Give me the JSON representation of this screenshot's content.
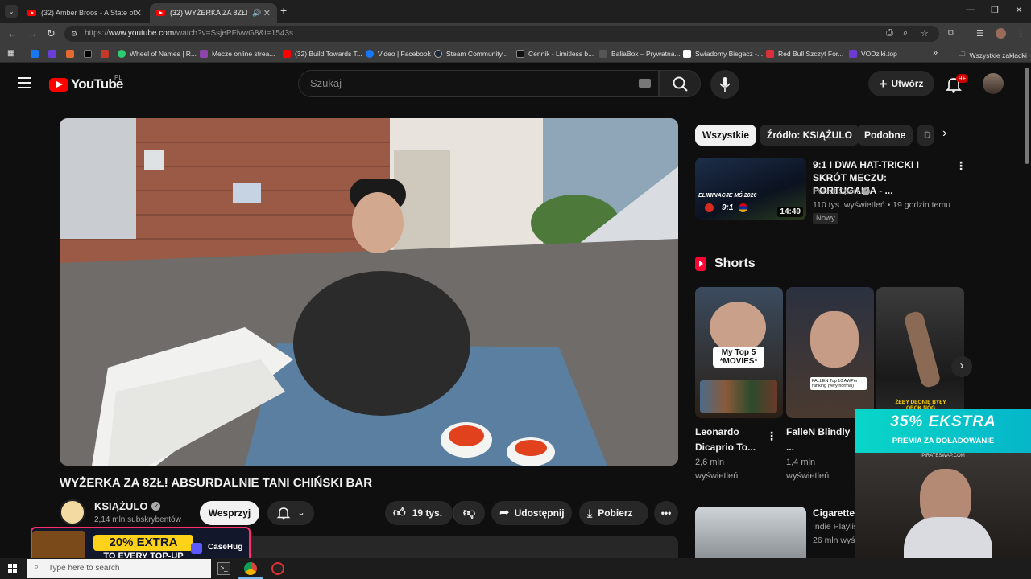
{
  "browser": {
    "tabs": [
      {
        "label": "(32) Amber Broos - A State of T"
      },
      {
        "label": "(32) WYŻERKA ZA 8ZŁ! ABS"
      }
    ],
    "url_prefix": "https://",
    "url_host": "www.youtube.com",
    "url_path": "/watch?v=SsjePFlvwG8&t=1543s",
    "bookmarks": [
      {
        "label": "",
        "color": "#1877f2"
      },
      {
        "label": "",
        "color": "#6a3fd8"
      },
      {
        "label": "",
        "color": "#e46a2f"
      },
      {
        "label": "",
        "color": "#000000"
      },
      {
        "label": "",
        "color": "#c0392b"
      },
      {
        "label": "Wheel of Names | R...",
        "color": "#2ecc71"
      },
      {
        "label": "Mecze online strea...",
        "color": "#8e44ad"
      },
      {
        "label": "(32) Build Towards T...",
        "color": "#ff0000"
      },
      {
        "label": "Video | Facebook",
        "color": "#1877f2"
      },
      {
        "label": "Steam Community...",
        "color": "#1b2838"
      },
      {
        "label": "Cennik - Limitless b...",
        "color": "#111111"
      },
      {
        "label": "BaliaBox – Prywatna...",
        "color": "#555555"
      },
      {
        "label": "Świadomy Biegacz -...",
        "color": "#ffffff"
      },
      {
        "label": "Red Bull Szczyt For...",
        "color": "#d9303a"
      },
      {
        "label": "VODziki.top",
        "color": "#6c3bd1"
      }
    ],
    "all_bookmarks": "Wszystkie zakładki"
  },
  "youtube": {
    "logo_text": "YouTube",
    "country": "PL",
    "search_placeholder": "Szukaj",
    "create_label": "Utwórz",
    "notifications_badge": "9+"
  },
  "video": {
    "title": "WYŻERKA ZA 8ZŁ! ABSURDALNIE TANI CHIŃSKI BAR",
    "channel": "KSIĄŻULO",
    "subscribers": "2,14 mln subskrybentów",
    "support_label": "Wesprzyj",
    "likes": "19 tys.",
    "share_label": "Udostępnij",
    "download_label": "Pobierz"
  },
  "sidebar": {
    "chips": [
      "Wszystkie",
      "Źródło: KSIĄŻULO",
      "Podobne",
      "D"
    ],
    "recommended": {
      "title": "9:1 I DWA HAT-TRICKI I SKRÓT MECZU: PORTUGALIA - ...",
      "channel": "Polsat Sport",
      "meta": "110 tys. wyświetleń • 19 godzin temu",
      "badge": "Nowy",
      "duration": "14:49",
      "thumb_text": "ELIMINACJE MŚ 2026",
      "score": "9:1"
    },
    "shorts_heading": "Shorts",
    "shorts": [
      {
        "title": "Leonardo Dicaprio To...",
        "views": "2,6 mln",
        "views_label": "wyświetleń",
        "thumb_text": "My Top 5 *MOVIES*"
      },
      {
        "title": "FalleN Blindly ...",
        "views": "1,4 mln",
        "views_label": "wyświetleń",
        "thumb_text": "FALLEN Top 10 AWPer ranking (very normal)"
      },
      {
        "title": "",
        "views": "",
        "views_label": "",
        "thumb_text": "ŻEBY DEONIE BYŁY OBOK NÓG"
      }
    ],
    "next_video": {
      "title": "Cigarettes",
      "channel": "Indie Playlis",
      "meta": "26 mln wyś"
    }
  },
  "overlays": {
    "ad_top": "35% EKSTRA",
    "ad_sub": "PREMIA ZA DOŁADOWANIE",
    "ad_site": "PIRATESWAP.COM",
    "casehug_top": "20% EXTRA",
    "casehug_sub": "TO EVERY TOP-UP",
    "casehug_brand": "CaseHug"
  },
  "taskbar": {
    "search_placeholder": "Type here to search"
  }
}
